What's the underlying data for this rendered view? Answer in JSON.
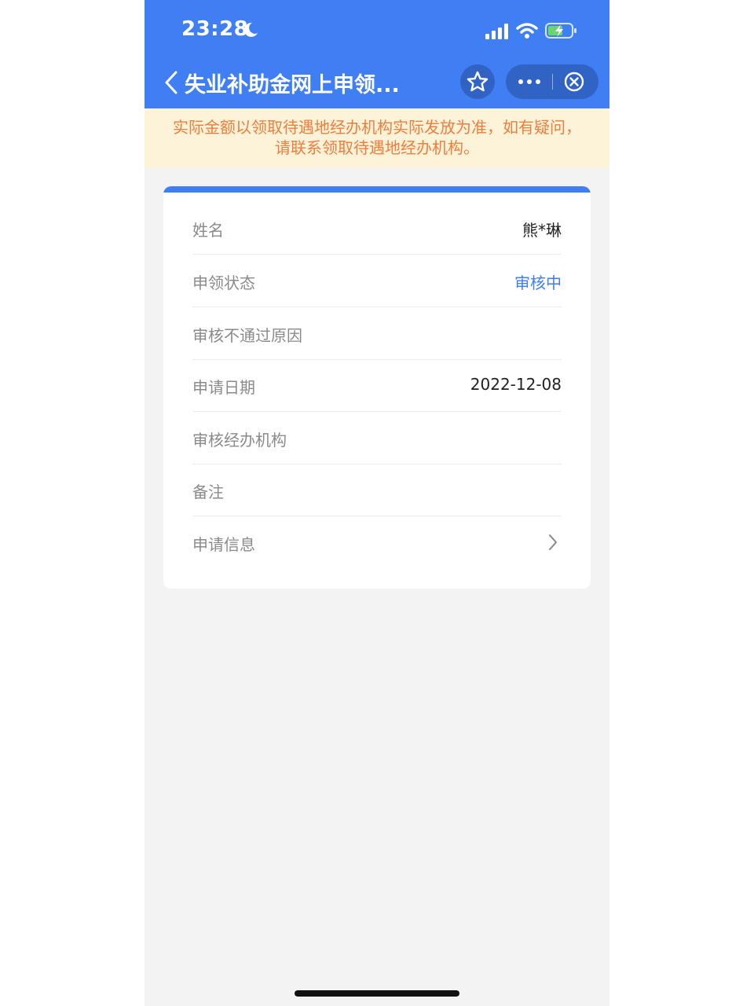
{
  "status_bar": {
    "time": "23:28"
  },
  "header": {
    "title": "失业补助金网上申领..."
  },
  "notice": {
    "line1": "实际金额以领取待遇地经办机构实际发放为准，如有疑问，",
    "line2": "请联系领取待遇地经办机构。"
  },
  "details": [
    {
      "label": "姓名",
      "value": "熊*琳"
    },
    {
      "label": "申领状态",
      "value": "审核中"
    },
    {
      "label": "审核不通过原因",
      "value": ""
    },
    {
      "label": "申请日期",
      "value": "2022-12-08"
    },
    {
      "label": "审核经办机构",
      "value": ""
    },
    {
      "label": "备注",
      "value": ""
    },
    {
      "label": "申请信息",
      "value": ""
    }
  ],
  "colors": {
    "brand": "#3f7ef3",
    "notice_text": "#f07d3c",
    "notice_bg": "#fdf3d9"
  },
  "icons": [
    "moon-icon",
    "signal-icon",
    "wifi-icon",
    "battery-charging-icon",
    "back-icon",
    "star-icon",
    "more-icon",
    "close-icon",
    "chevron-right-icon"
  ]
}
